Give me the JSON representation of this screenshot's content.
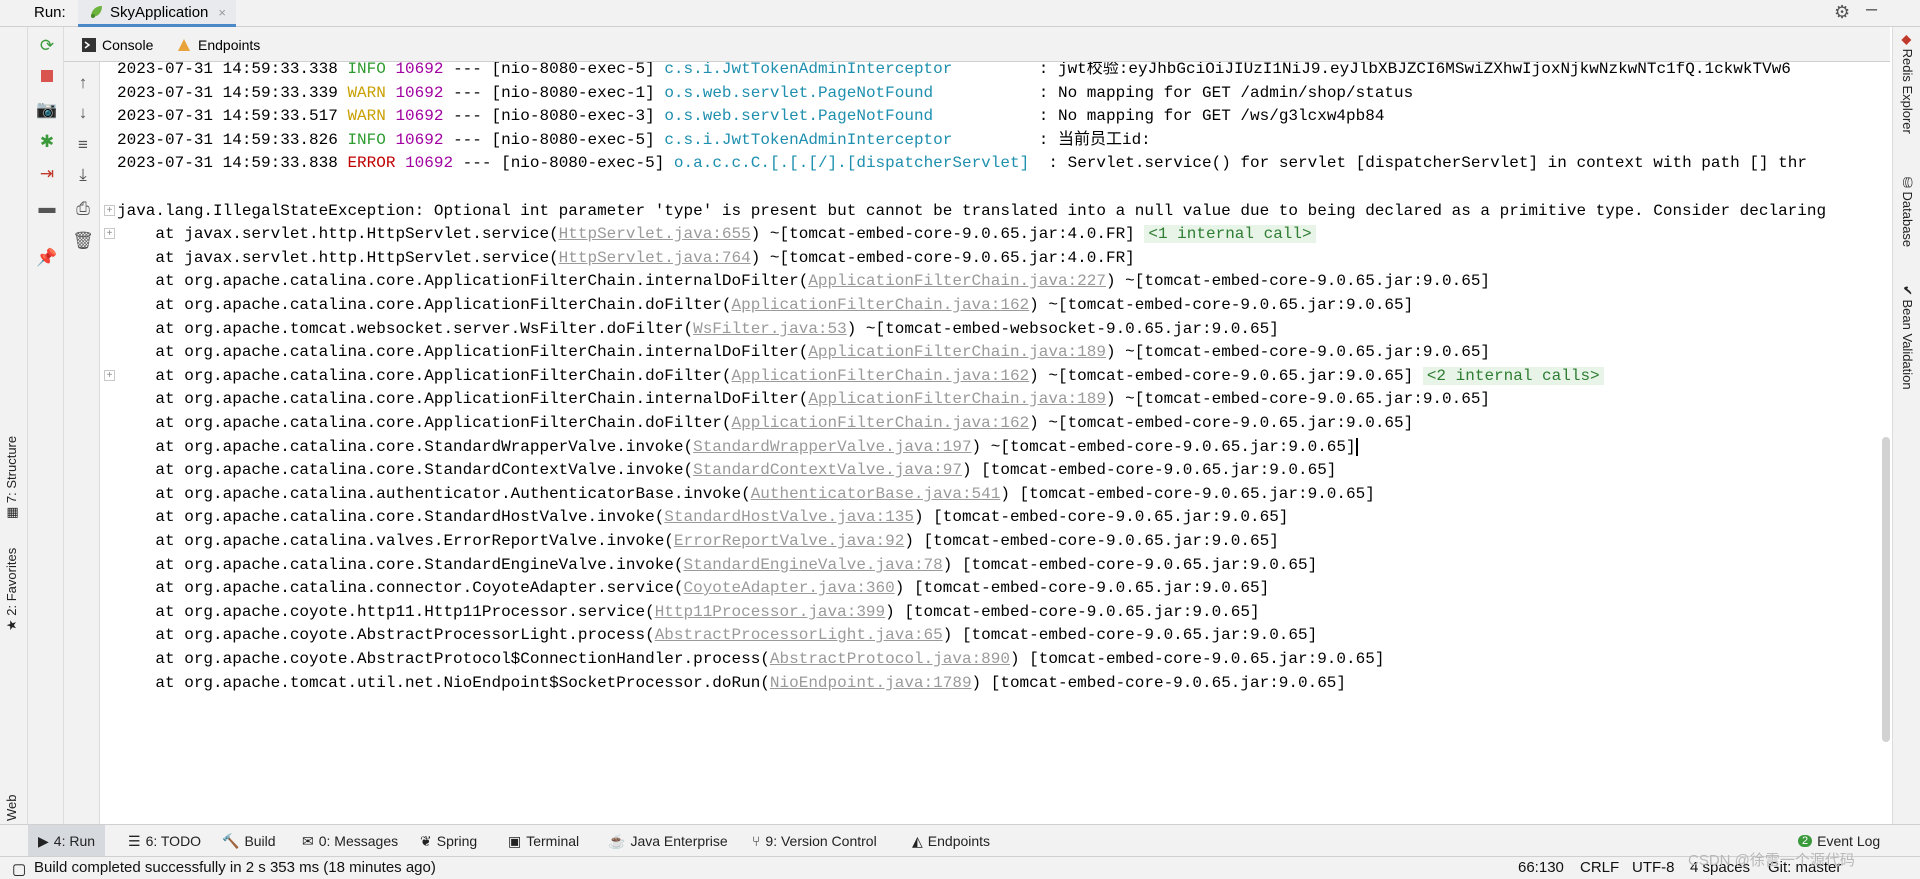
{
  "run_bar": {
    "label": "Run:",
    "tab_label": "SkyApplication",
    "close_glyph": "×"
  },
  "sub_tabs": [
    {
      "label": "Console",
      "icon": "console-icon"
    },
    {
      "label": "Endpoints",
      "icon": "endpoints-icon"
    }
  ],
  "console": {
    "lines": [
      {
        "type": "log",
        "time": "2023-07-31 14:59:33.338",
        "level": "INFO",
        "level_pad": " INFO ",
        "pid": "10692",
        "thread": " --- [nio-8080-exec-5] ",
        "logger": "c.s.i.JwtTokenAdminInterceptor",
        "logger_pad": "        ",
        "message": " : jwt校验:eyJhbGciOiJIUzI1NiJ9.eyJlbXBJZCI6MSwiZXhwIjoxNjkwNzkwNTc1fQ.1ckwkTVw6"
      },
      {
        "type": "log",
        "time": "2023-07-31 14:59:33.339",
        "level": "WARN",
        "level_pad": " WARN ",
        "pid": "10692",
        "thread": " --- [nio-8080-exec-1] ",
        "logger": "o.s.web.servlet.PageNotFound",
        "logger_pad": "          ",
        "message": " : No mapping for GET /admin/shop/status"
      },
      {
        "type": "log",
        "time": "2023-07-31 14:59:33.517",
        "level": "WARN",
        "level_pad": " WARN ",
        "pid": "10692",
        "thread": " --- [nio-8080-exec-3] ",
        "logger": "o.s.web.servlet.PageNotFound",
        "logger_pad": "          ",
        "message": " : No mapping for GET /ws/g3lcxw4pb84"
      },
      {
        "type": "log",
        "time": "2023-07-31 14:59:33.826",
        "level": "INFO",
        "level_pad": " INFO ",
        "pid": "10692",
        "thread": " --- [nio-8080-exec-5] ",
        "logger": "c.s.i.JwtTokenAdminInterceptor",
        "logger_pad": "        ",
        "message": " : 当前员工id:"
      },
      {
        "type": "log",
        "time": "2023-07-31 14:59:33.838",
        "level": "ERROR",
        "level_pad": " ERROR ",
        "pid": "10692",
        "thread": " --- [nio-8080-exec-5] ",
        "logger": "o.a.c.c.C.[.[.[/].[dispatcherServlet]",
        "logger_pad": " ",
        "message": " : Servlet.service() for servlet [dispatcherServlet] in context with path [] thr"
      },
      {
        "type": "blank"
      },
      {
        "type": "exception",
        "fold": "+",
        "text": "java.lang.IllegalStateException: Optional int parameter 'type' is present but cannot be translated into a null value due to being declared as a primitive type. Consider declaring"
      },
      {
        "type": "frame",
        "fold": "+",
        "prefix": "    at javax.servlet.http.HttpServlet.service(",
        "link": "HttpServlet.java:655",
        "suffix": ") ~[tomcat-embed-core-9.0.65.jar:4.0.FR]",
        "note": "<1 internal call>"
      },
      {
        "type": "frame",
        "prefix": "    at javax.servlet.http.HttpServlet.service(",
        "link": "HttpServlet.java:764",
        "suffix": ") ~[tomcat-embed-core-9.0.65.jar:4.0.FR]"
      },
      {
        "type": "frame",
        "prefix": "    at org.apache.catalina.core.ApplicationFilterChain.internalDoFilter(",
        "link": "ApplicationFilterChain.java:227",
        "suffix": ") ~[tomcat-embed-core-9.0.65.jar:9.0.65]"
      },
      {
        "type": "frame",
        "prefix": "    at org.apache.catalina.core.ApplicationFilterChain.doFilter(",
        "link": "ApplicationFilterChain.java:162",
        "suffix": ") ~[tomcat-embed-core-9.0.65.jar:9.0.65]"
      },
      {
        "type": "frame",
        "prefix": "    at org.apache.tomcat.websocket.server.WsFilter.doFilter(",
        "link": "WsFilter.java:53",
        "suffix": ") ~[tomcat-embed-websocket-9.0.65.jar:9.0.65]"
      },
      {
        "type": "frame",
        "prefix": "    at org.apache.catalina.core.ApplicationFilterChain.internalDoFilter(",
        "link": "ApplicationFilterChain.java:189",
        "suffix": ") ~[tomcat-embed-core-9.0.65.jar:9.0.65]"
      },
      {
        "type": "frame",
        "fold": "+",
        "prefix": "    at org.apache.catalina.core.ApplicationFilterChain.doFilter(",
        "link": "ApplicationFilterChain.java:162",
        "suffix": ") ~[tomcat-embed-core-9.0.65.jar:9.0.65]",
        "note": "<2 internal calls>"
      },
      {
        "type": "frame",
        "prefix": "    at org.apache.catalina.core.ApplicationFilterChain.internalDoFilter(",
        "link": "ApplicationFilterChain.java:189",
        "suffix": ") ~[tomcat-embed-core-9.0.65.jar:9.0.65]"
      },
      {
        "type": "frame",
        "prefix": "    at org.apache.catalina.core.ApplicationFilterChain.doFilter(",
        "link": "ApplicationFilterChain.java:162",
        "suffix": ") ~[tomcat-embed-core-9.0.65.jar:9.0.65]"
      },
      {
        "type": "frame",
        "prefix": "    at org.apache.catalina.core.StandardWrapperValve.invoke(",
        "link": "StandardWrapperValve.java:197",
        "suffix": ") ~[tomcat-embed-core-9.0.65.jar:9.0.65]",
        "cursor": true
      },
      {
        "type": "frame",
        "prefix": "    at org.apache.catalina.core.StandardContextValve.invoke(",
        "link": "StandardContextValve.java:97",
        "suffix": ") [tomcat-embed-core-9.0.65.jar:9.0.65]"
      },
      {
        "type": "frame",
        "prefix": "    at org.apache.catalina.authenticator.AuthenticatorBase.invoke(",
        "link": "AuthenticatorBase.java:541",
        "suffix": ") [tomcat-embed-core-9.0.65.jar:9.0.65]"
      },
      {
        "type": "frame",
        "prefix": "    at org.apache.catalina.core.StandardHostValve.invoke(",
        "link": "StandardHostValve.java:135",
        "suffix": ") [tomcat-embed-core-9.0.65.jar:9.0.65]"
      },
      {
        "type": "frame",
        "prefix": "    at org.apache.catalina.valves.ErrorReportValve.invoke(",
        "link": "ErrorReportValve.java:92",
        "suffix": ") [tomcat-embed-core-9.0.65.jar:9.0.65]"
      },
      {
        "type": "frame",
        "prefix": "    at org.apache.catalina.core.StandardEngineValve.invoke(",
        "link": "StandardEngineValve.java:78",
        "suffix": ") [tomcat-embed-core-9.0.65.jar:9.0.65]"
      },
      {
        "type": "frame",
        "prefix": "    at org.apache.catalina.connector.CoyoteAdapter.service(",
        "link": "CoyoteAdapter.java:360",
        "suffix": ") [tomcat-embed-core-9.0.65.jar:9.0.65]"
      },
      {
        "type": "frame",
        "prefix": "    at org.apache.coyote.http11.Http11Processor.service(",
        "link": "Http11Processor.java:399",
        "suffix": ") [tomcat-embed-core-9.0.65.jar:9.0.65]"
      },
      {
        "type": "frame",
        "prefix": "    at org.apache.coyote.AbstractProcessorLight.process(",
        "link": "AbstractProcessorLight.java:65",
        "suffix": ") [tomcat-embed-core-9.0.65.jar:9.0.65]"
      },
      {
        "type": "frame",
        "prefix": "    at org.apache.coyote.AbstractProtocol$ConnectionHandler.process(",
        "link": "AbstractProtocol.java:890",
        "suffix": ") [tomcat-embed-core-9.0.65.jar:9.0.65]"
      },
      {
        "type": "frame",
        "prefix": "    at org.apache.tomcat.util.net.NioEndpoint$SocketProcessor.doRun(",
        "link": "NioEndpoint.java:1789",
        "suffix": ") [tomcat-embed-core-9.0.65.jar:9.0.65]"
      }
    ]
  },
  "left_tabs": [
    {
      "label": "7: Structure",
      "icon": "structure-icon"
    },
    {
      "label": "2: Favorites",
      "icon": "star-icon"
    },
    {
      "label": "Web",
      "icon": "web-icon"
    }
  ],
  "right_tabs": [
    {
      "label": "Redis Explorer",
      "icon": "redis-icon"
    },
    {
      "label": "Database",
      "icon": "database-icon"
    },
    {
      "label": "Bean Validation",
      "icon": "bean-validation-icon"
    }
  ],
  "tool_windows": [
    {
      "label": "4: Run",
      "icon": "run-icon",
      "active": true
    },
    {
      "label": "6: TODO",
      "icon": "todo-icon"
    },
    {
      "label": "Build",
      "icon": "build-icon"
    },
    {
      "label": "0: Messages",
      "icon": "messages-icon"
    },
    {
      "label": "Spring",
      "icon": "spring-icon"
    },
    {
      "label": "Terminal",
      "icon": "terminal-icon"
    },
    {
      "label": "Java Enterprise",
      "icon": "java-enterprise-icon"
    },
    {
      "label": "9: Version Control",
      "icon": "version-control-icon"
    },
    {
      "label": "Endpoints",
      "icon": "endpoints-icon"
    }
  ],
  "event_log": {
    "label": "Event Log",
    "badge": "2"
  },
  "status_bar": {
    "message": "Build completed successfully in 2 s 353 ms (18 minutes ago)",
    "position": "66:130",
    "line_sep": "CRLF",
    "encoding": "UTF-8",
    "indent": "4 spaces",
    "vcs": "Git: master"
  },
  "watermark": "CSDN @徐雷一个源代码",
  "colors": {
    "info": "#2d9b2f",
    "warn": "#c8a000",
    "error": "#c00000",
    "pid": "#a000a0",
    "logger": "#1e8fae",
    "link": "#9a9a9a"
  }
}
